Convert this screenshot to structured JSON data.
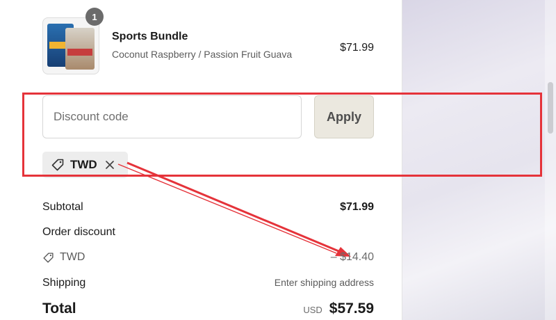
{
  "product": {
    "quantity": "1",
    "name": "Sports Bundle",
    "variant": "Coconut Raspberry / Passion Fruit Guava",
    "price": "$71.99",
    "image_icon": "product-image"
  },
  "discount": {
    "placeholder": "Discount code",
    "apply_label": "Apply",
    "applied_code": "TWD",
    "tag_icon": "tag-icon",
    "remove_icon": "close-icon"
  },
  "summary": {
    "subtotal_label": "Subtotal",
    "subtotal_value": "$71.99",
    "order_discount_label": "Order discount",
    "discount_code": "TWD",
    "discount_value": "– $14.40",
    "shipping_label": "Shipping",
    "shipping_value": "Enter shipping address",
    "total_label": "Total",
    "total_currency": "USD",
    "total_value": "$57.59"
  },
  "annotation": {
    "color": "#e5333a"
  }
}
